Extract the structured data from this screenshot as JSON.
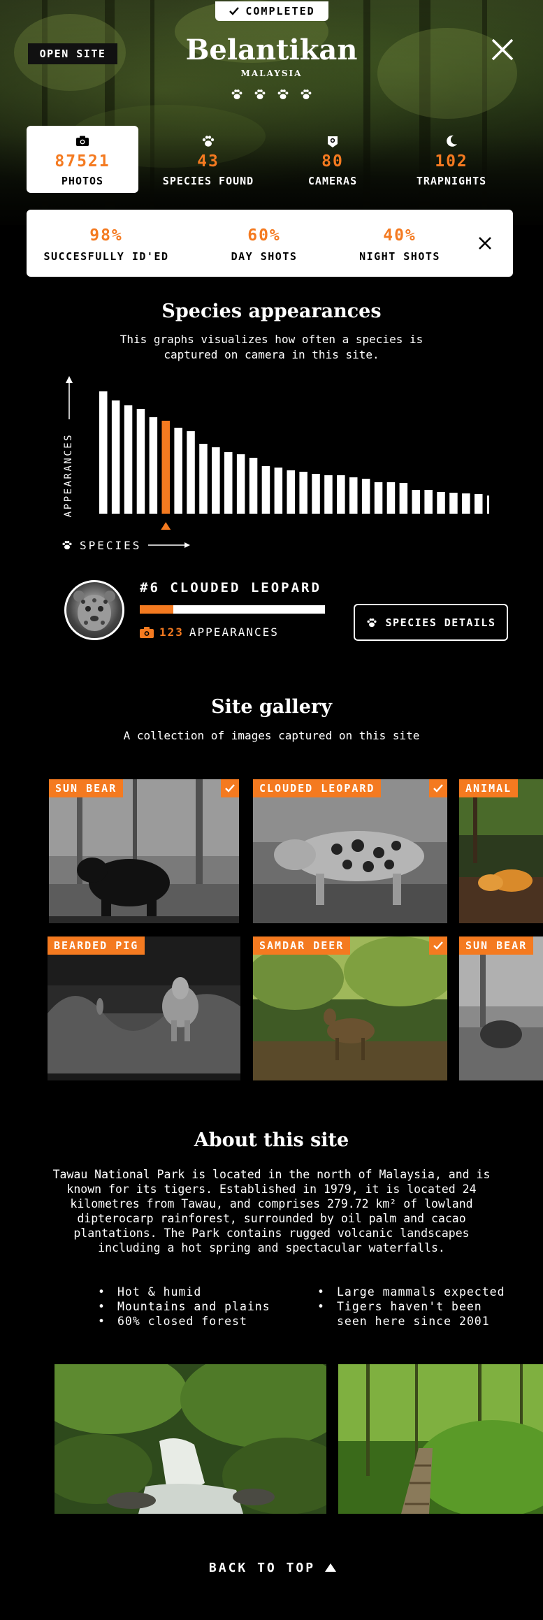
{
  "status": {
    "label": "COMPLETED"
  },
  "header": {
    "open_site": "OPEN SITE",
    "title": "Belantikan",
    "country": "MALAYSIA",
    "rating_paws": 4
  },
  "stats": [
    {
      "icon": "camera-icon",
      "value": "87521",
      "label": "PHOTOS",
      "active": true
    },
    {
      "icon": "paw-icon",
      "value": "43",
      "label": "SPECIES FOUND",
      "active": false
    },
    {
      "icon": "trail-camera-icon",
      "value": "80",
      "label": "CAMERAS",
      "active": false
    },
    {
      "icon": "moon-icon",
      "value": "102",
      "label": "TRAPNIGHTS",
      "active": false
    }
  ],
  "identification": [
    {
      "value": "98%",
      "label": "SUCCESFULLY ID'ED"
    },
    {
      "value": "60%",
      "label": "DAY SHOTS"
    },
    {
      "value": "40%",
      "label": "NIGHT SHOTS"
    }
  ],
  "species_section": {
    "title": "Species appearances",
    "subtitle": "This graphs visualizes how often a species is captured on camera in this site.",
    "species_axis_label": "SPECIES"
  },
  "chart_data": {
    "type": "bar",
    "ylabel": "APPEARANCES",
    "xlabel": "SPECIES",
    "values": [
      175,
      162,
      155,
      150,
      138,
      133,
      123,
      118,
      100,
      95,
      88,
      85,
      80,
      68,
      66,
      62,
      60,
      57,
      55,
      55,
      52,
      50,
      45,
      45,
      44,
      34,
      34,
      31,
      30,
      29,
      28,
      26
    ],
    "highlight_index": 5,
    "highlight_color": "#f47a20",
    "bar_color": "#ffffff"
  },
  "selected_species": {
    "rank_name": "#6 CLOUDED LEOPARD",
    "appearances_value": "123",
    "appearances_label": "APPEARANCES",
    "bar_fraction": 0.18,
    "details_button": "SPECIES DETAILS"
  },
  "gallery_section": {
    "title": "Site gallery",
    "subtitle": "A collection of images captured on this site",
    "items": [
      {
        "label": "SUN BEAR",
        "checked": true
      },
      {
        "label": "CLOUDED LEOPARD",
        "checked": true
      },
      {
        "label": "ANIMAL",
        "checked": false
      },
      {
        "label": "BEARDED PIG",
        "checked": false
      },
      {
        "label": "SAMDAR DEER",
        "checked": true
      },
      {
        "label": "SUN BEAR",
        "checked": false
      }
    ]
  },
  "about_section": {
    "title": "About this site",
    "text": "Tawau National Park is located in the north of Malaysia, and is known for its tigers. Established in 1979, it is located 24 kilometres from Tawau, and comprises 279.72 km² of lowland dipterocarp rainforest, surrounded by oil palm and cacao plantations. The Park contains rugged volcanic landscapes including a hot spring and spectacular waterfalls.",
    "bullets_left": [
      "Hot & humid",
      "Mountains and plains",
      "60% closed forest"
    ],
    "bullets_right": [
      "Large mammals expected",
      "Tigers haven't been seen here since 2001"
    ]
  },
  "footer": {
    "back_to_top": "BACK TO TOP"
  },
  "colors": {
    "accent": "#f47a20",
    "background": "#000000",
    "card": "#ffffff"
  }
}
